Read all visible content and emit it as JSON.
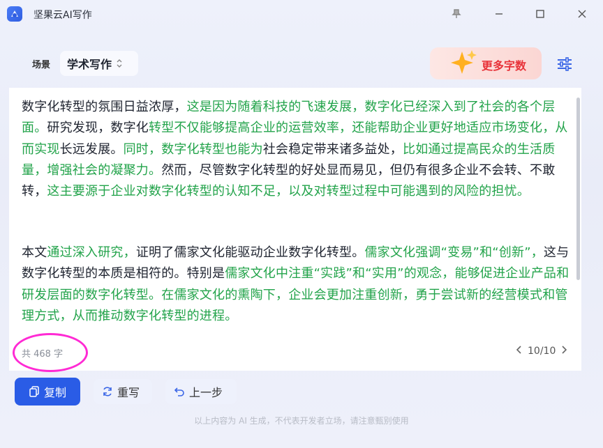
{
  "app": {
    "title": "坚果云AI写作"
  },
  "toolbar": {
    "scene_label": "场景",
    "scene_value": "学术写作",
    "more_words_label": "更多字数"
  },
  "content": {
    "paragraph1": [
      {
        "text": "数字化转型的氛围日益浓厚，",
        "green": false
      },
      {
        "text": "这是因为随着科技的飞速发展，数字化已经深入到了社会的各个层面。",
        "green": true
      },
      {
        "text": "研究发现，数字化",
        "green": false
      },
      {
        "text": "转型不仅能够提高企业的运营效率，还能帮助企业更好地适应市场变化，从而实现",
        "green": true
      },
      {
        "text": "长远发展。",
        "green": false
      },
      {
        "text": "同时，数字化转型也能为",
        "green": true
      },
      {
        "text": "社会稳定带来诸多益处，",
        "green": false
      },
      {
        "text": "比如通过提高民众的生活质量，增强社会的凝聚力。",
        "green": true
      },
      {
        "text": "然而，尽管数字化转型的好处显而易见，但仍有很多企业不会转、不敢转，",
        "green": false
      },
      {
        "text": "这主要源于企业对数字化转型的认知不足，以及对转型过程中可能遇到的风险的担忧。",
        "green": true
      }
    ],
    "paragraph2": [
      {
        "text": "本文",
        "green": false
      },
      {
        "text": "通过深入研究，",
        "green": true
      },
      {
        "text": "证明了儒家文化能驱动企业数字化转型。",
        "green": false
      },
      {
        "text": "儒家文化强调“变易”和“创新”，",
        "green": true
      },
      {
        "text": "这与数字化转型的本质是相符的。特别是",
        "green": false
      },
      {
        "text": "儒家文化中注重“实践”和“实用”的观念，能够促进企业产品和研发层面的数字化转型。",
        "green": true
      },
      {
        "text": "在儒家文化的熏陶下，企业会更加注重创新，勇于尝试新的经营模式和管理方式，从而推动数字化转型的进程。",
        "green": true
      }
    ],
    "word_count": "共 468 字",
    "pager": "10/10"
  },
  "actions": {
    "copy_label": "复制",
    "rewrite_label": "重写",
    "back_label": "上一步"
  },
  "footer": {
    "disclaimer": "以上内容为 AI 生成，不代表开发者立场，请注意甄别使用"
  },
  "colors": {
    "accent": "#2a5ce6",
    "green_text": "#22a34a",
    "more_words_text": "#e8333a"
  },
  "icons": [
    "app-logo-icon",
    "pin-icon",
    "minimize-icon",
    "maximize-icon",
    "close-icon",
    "sparkle-star-icon",
    "settings-sliders-icon",
    "copy-icon",
    "refresh-icon",
    "undo-icon",
    "chevron-left-icon",
    "chevron-right-icon"
  ]
}
